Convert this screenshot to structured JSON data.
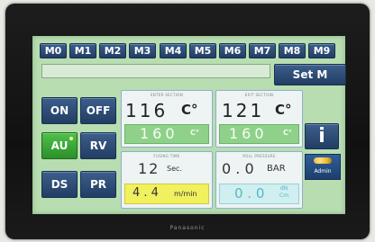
{
  "top_buttons": [
    "M0",
    "M1",
    "M2",
    "M3",
    "M4",
    "M5",
    "M6",
    "M7",
    "M8",
    "M9"
  ],
  "set_m_label": "Set M",
  "left_buttons": {
    "on": "ON",
    "off": "OFF",
    "au": "AU",
    "rv": "RV",
    "ds": "DS",
    "pr": "PR"
  },
  "enter_section": {
    "label": "ENTER SECTION",
    "actual": "116",
    "unit": "C°",
    "setpoint": "160",
    "setpoint_unit": "C°"
  },
  "exit_section": {
    "label": "EXIT SECTION",
    "actual": "121",
    "unit": "C°",
    "setpoint": "160",
    "setpoint_unit": "C°"
  },
  "fusing_time": {
    "label": "FUSING TIME",
    "value": "12",
    "unit": "Sec.",
    "speed": "4 . 4",
    "speed_unit": "m/min"
  },
  "roll_pressure": {
    "label": "ROLL PRESSURE",
    "value": "0 . 0",
    "unit": "BAR",
    "force": "0 . 0",
    "force_unit_top": "dN",
    "force_unit_bottom": "Cm"
  },
  "info_label": "i",
  "admin_label": "Admin",
  "brand": "Panasonic"
}
